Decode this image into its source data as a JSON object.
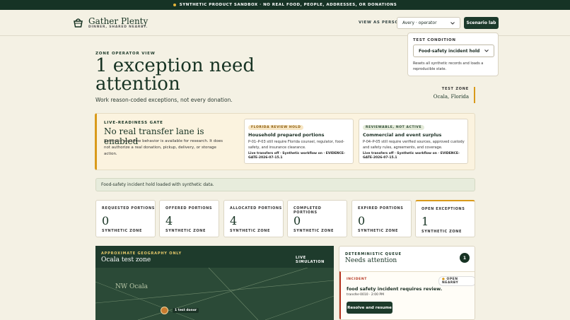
{
  "banner": {
    "text": "SYNTHETIC PRODUCT SANDBOX · NO REAL FOOD, PEOPLE, ADDRESSES, OR DONATIONS"
  },
  "brand": {
    "name": "Gather Plenty",
    "tagline": "DINNER, SHARED NEARBY."
  },
  "header": {
    "view_as_label": "VIEW AS PERSON",
    "person_value": "Avery · operator",
    "scenario_button": "Scenario lab"
  },
  "dropdown": {
    "title": "TEST CONDITION",
    "value": "Food-safety incident hold",
    "help": "Resets all synthetic records and loads a reproducible state."
  },
  "hero": {
    "eyebrow": "ZONE OPERATOR VIEW",
    "headline": "1 exception need attention",
    "subline": "Work reason-coded exceptions, not every donation."
  },
  "test_zone": {
    "label": "TEST ZONE",
    "value": "Ocala, Florida"
  },
  "gate": {
    "label": "LIVE-READINESS GATE",
    "title": "No real transfer lane is enabled",
    "body": "Synthetic workflow behavior is available for research. It does not authorize a real donation, pickup, delivery, or storage action."
  },
  "cards": [
    {
      "badge": "FLORIDA REVIEW HOLD",
      "title": "Household prepared portions",
      "body": "P-01–P-03 still require Florida counsel, regulator, food-safety, and insurance clearance.",
      "foot": "Live transfers off · Synthetic workflow on · EVIDENCE-GATE-2026-07-15.1"
    },
    {
      "badge": "REVIEWABLE, NOT ACTIVE",
      "title": "Commercial and event surplus",
      "body": "P-04–P-05 still require verified sources, approved custody and safety rules, agreements, and coverage.",
      "foot": "Live transfers off · Synthetic workflow on · EVIDENCE-GATE-2026-07-15.1"
    }
  ],
  "loaded_notice": "Food-safety incident hold loaded with synthetic data.",
  "stats": [
    {
      "label": "REQUESTED PORTIONS",
      "value": "0",
      "zone": "SYNTHETIC ZONE"
    },
    {
      "label": "OFFERED PORTIONS",
      "value": "4",
      "zone": "SYNTHETIC ZONE"
    },
    {
      "label": "ALLOCATED PORTIONS",
      "value": "4",
      "zone": "SYNTHETIC ZONE"
    },
    {
      "label": "COMPLETED PORTIONS",
      "value": "0",
      "zone": "SYNTHETIC ZONE"
    },
    {
      "label": "EXPIRED PORTIONS",
      "value": "0",
      "zone": "SYNTHETIC ZONE"
    },
    {
      "label": "OPEN EXCEPTIONS",
      "value": "1",
      "zone": "SYNTHETIC ZONE"
    }
  ],
  "map": {
    "eyebrow": "APPROXIMATE GEOGRAPHY ONLY",
    "title": "Ocala test zone",
    "live": "LIVE SIMULATION",
    "place": "NW Ocala",
    "pin_label": "1 test donor"
  },
  "queue": {
    "eyebrow": "DETERMINISTIC QUEUE",
    "title": "Needs attention",
    "count": "1",
    "item": {
      "label": "INCIDENT",
      "status": "OPEN NEARBY",
      "title": "food safety incident requires review.",
      "meta": "transfer-0010 · 2:00 PM",
      "button": "Resolve and resume"
    }
  },
  "colors": {
    "primary": "#1c3a2b",
    "accent": "#d99a1a",
    "alert": "#b5341f",
    "background": "#f4f1e4"
  }
}
